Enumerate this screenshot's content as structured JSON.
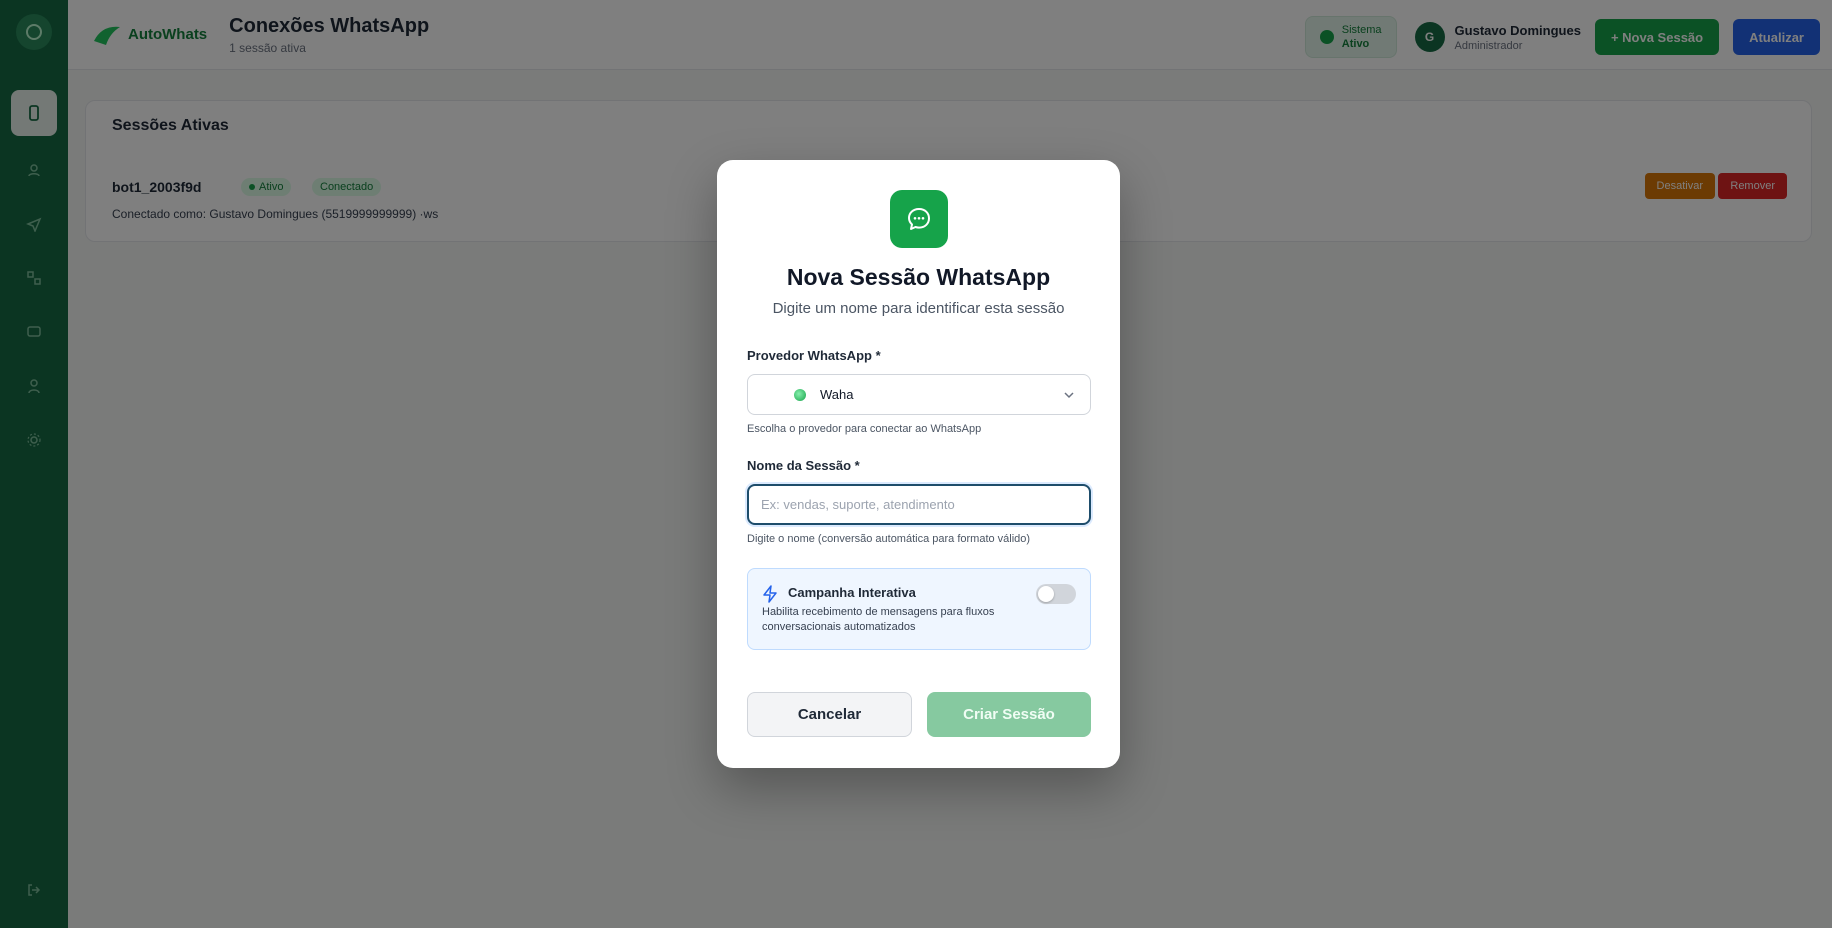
{
  "brand": {
    "name": "AutoWhats"
  },
  "header": {
    "title": "Conexões WhatsApp",
    "subtitle": "1 sessão ativa",
    "status_line1": "Sistema",
    "status_line2": "Ativo",
    "user_initials": "G",
    "user_name": "Gustavo Domingues",
    "user_role": "Administrador",
    "new_session_label": "+ Nova Sessão",
    "refresh_label": "Atualizar"
  },
  "sessions": {
    "title": "Sessões Ativas",
    "items": [
      {
        "name": "bot1_2003f9d",
        "status": "Ativo",
        "connection": "Conectado",
        "description": "Conectado como: Gustavo Domingues (5519999999999) ·ws",
        "disconnect_label": "Desativar",
        "remove_label": "Remover"
      }
    ]
  },
  "modal": {
    "title": "Nova Sessão WhatsApp",
    "subtitle": "Digite um nome para identificar esta sessão",
    "provider_label": "Provedor WhatsApp *",
    "provider_value": "Waha",
    "provider_hint": "Escolha o provedor para conectar ao WhatsApp",
    "name_label": "Nome da Sessão *",
    "name_placeholder": "Ex: vendas, suporte, atendimento",
    "name_value": "",
    "name_hint": "Digite o nome (conversão automática para formato válido)",
    "campaign_title": "Campanha Interativa",
    "campaign_desc": "Habilita recebimento de mensagens para fluxos conversacionais automatizados",
    "campaign_enabled": false,
    "cancel_label": "Cancelar",
    "create_label": "Criar Sessão"
  },
  "colors": {
    "sidebar": "#166b45",
    "accent_green": "#16a34a",
    "create_button_disabled": "#86c9a0"
  }
}
